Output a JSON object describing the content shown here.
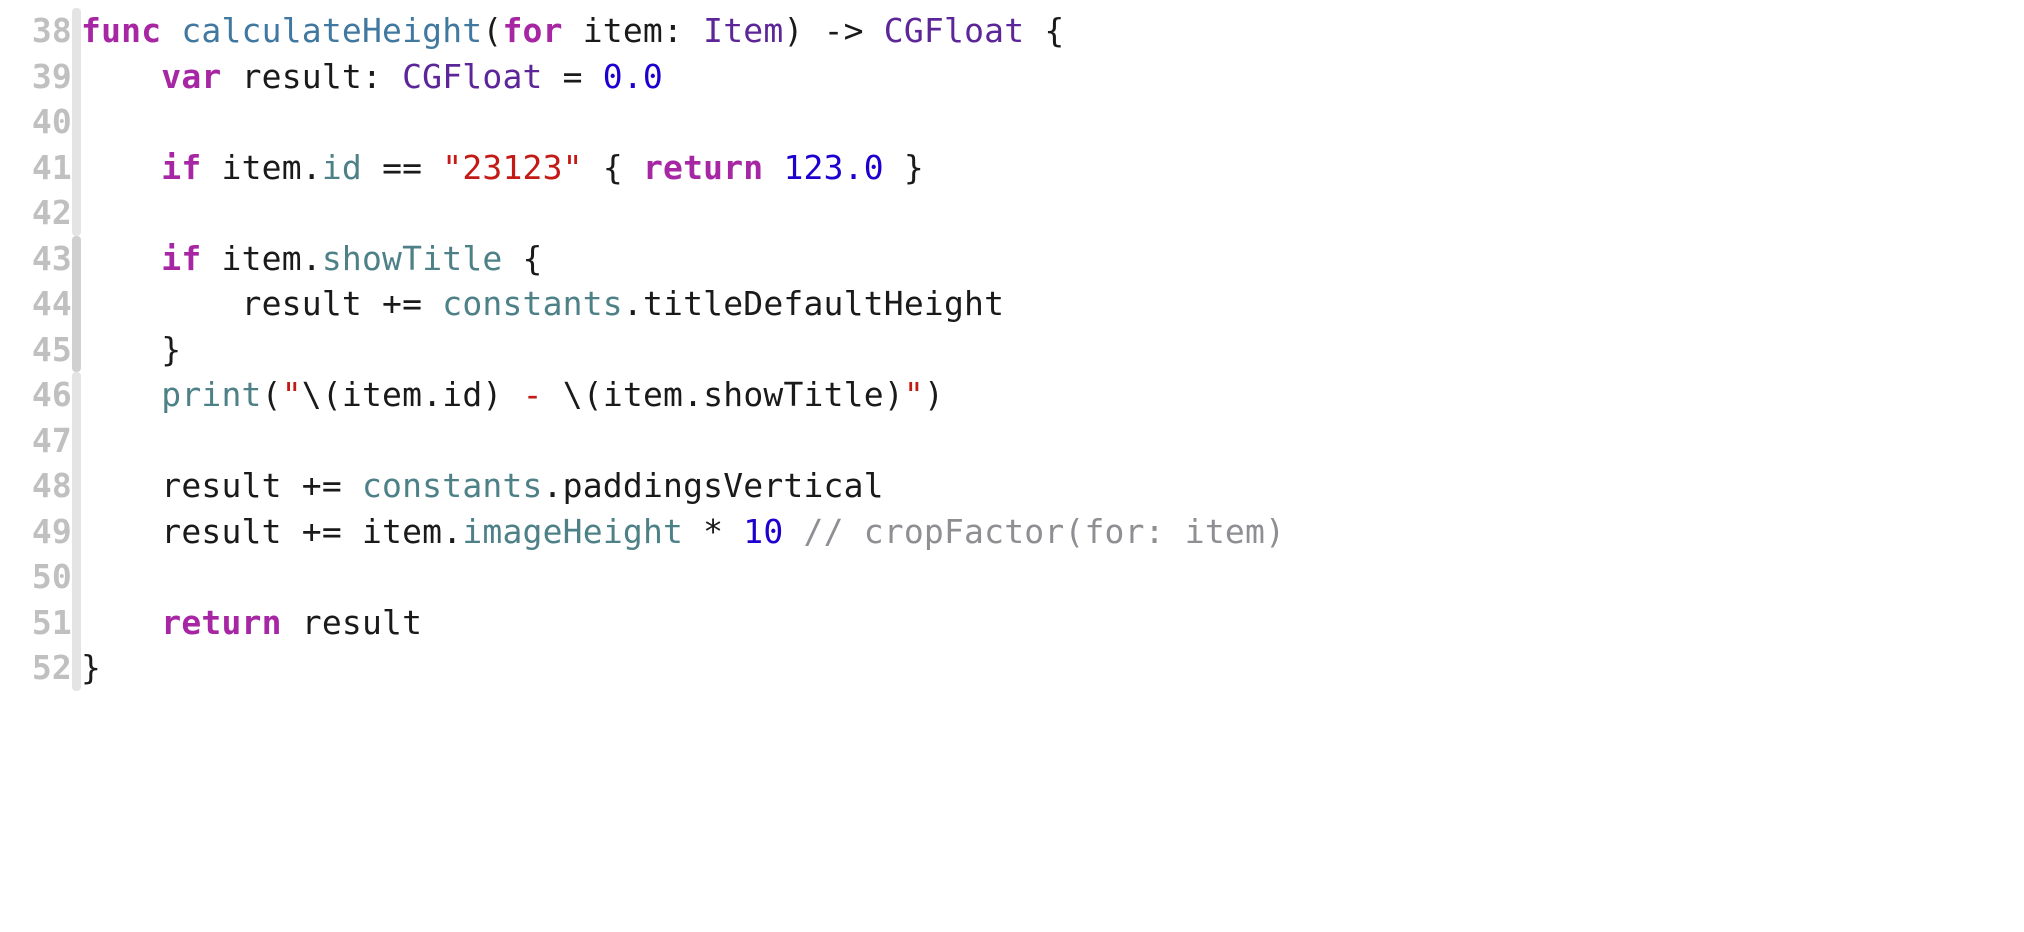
{
  "lines": {
    "start": 38,
    "numbers": [
      "38",
      "39",
      "40",
      "41",
      "42",
      "43",
      "44",
      "45",
      "46",
      "47",
      "48",
      "49",
      "50",
      "51",
      "52"
    ]
  },
  "code": {
    "l38": {
      "kw_func": "func",
      "sp1": " ",
      "fn_name": "calculateHeight",
      "paren_open": "(",
      "kw_for": "for",
      "sp2": " ",
      "param": "item",
      "colon": ": ",
      "type_item": "Item",
      "paren_close": ")",
      "arrow": " -> ",
      "type_cgfloat": "CGFloat",
      "brace": " {"
    },
    "l39": {
      "indent": "    ",
      "kw_var": "var",
      "sp1": " ",
      "name": "result",
      "colon": ": ",
      "type": "CGFloat",
      "eq": " = ",
      "num": "0.0"
    },
    "l40": {
      "blank": ""
    },
    "l41": {
      "indent": "    ",
      "kw_if": "if",
      "sp1": " ",
      "obj": "item",
      "dot": ".",
      "member": "id",
      "eqeq": " == ",
      "str": "\"23123\"",
      "brace_open": " { ",
      "kw_return": "return",
      "sp2": " ",
      "num": "123.0",
      "brace_close": " }"
    },
    "l42": {
      "blank": ""
    },
    "l43": {
      "indent": "    ",
      "kw_if": "if",
      "sp1": " ",
      "obj": "item",
      "dot": ".",
      "member": "showTitle",
      "brace": " {"
    },
    "l44": {
      "indent": "        ",
      "name": "result ",
      "op": "+=",
      "sp1": " ",
      "obj": "constants",
      "dot": ".",
      "member": "titleDefaultHeight"
    },
    "l45": {
      "indent": "    ",
      "brace": "}"
    },
    "l46": {
      "indent": "    ",
      "fn": "print",
      "paren_open": "(",
      "q1": "\"",
      "intp1_open": "\\(",
      "obj1": "item",
      "dot1": ".",
      "mem1": "id",
      "intp1_close": ")",
      "mid": " - ",
      "intp2_open": "\\(",
      "obj2": "item",
      "dot2": ".",
      "mem2": "showTitle",
      "intp2_close": ")",
      "q2": "\"",
      "paren_close": ")"
    },
    "l47": {
      "blank": ""
    },
    "l48": {
      "indent": "    ",
      "name": "result ",
      "op": "+=",
      "sp1": " ",
      "obj": "constants",
      "dot": ".",
      "member": "paddingsVertical"
    },
    "l49": {
      "indent": "    ",
      "name": "result ",
      "op": "+=",
      "sp1": " ",
      "obj": "item",
      "dot": ".",
      "member": "imageHeight",
      "mul": " * ",
      "num": "10",
      "sp2": " ",
      "comment": "// cropFactor(for: item)"
    },
    "l50": {
      "blank": ""
    },
    "l51": {
      "indent": "    ",
      "kw_return": "return",
      "sp1": " ",
      "name": "result"
    },
    "l52": {
      "brace": "}"
    }
  },
  "change_markers": [
    "light",
    "light",
    "light",
    "light",
    "light",
    "dark",
    "dark",
    "dark",
    "light",
    "light",
    "light",
    "light",
    "light",
    "light",
    "light"
  ]
}
